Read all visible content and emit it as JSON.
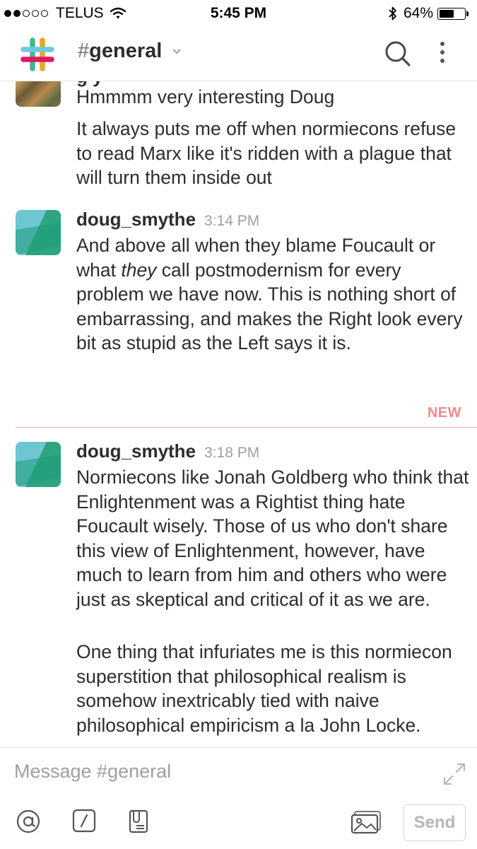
{
  "status_bar": {
    "carrier": "TELUS",
    "time": "5:45 PM",
    "battery": "64%",
    "battery_level": 0.64
  },
  "header": {
    "channel_hash": "#",
    "channel_name": "general",
    "logo_icon": "slack-logo-icon",
    "search_icon": "search-icon",
    "more_icon": "more-vertical-icon"
  },
  "messages": [
    {
      "avatar": "painting-avatar",
      "lines": [
        "Hmmmm very interesting Doug",
        "It always puts me off when normiecons refuse to read Marx like it's ridden with a plague that will turn them inside out"
      ]
    },
    {
      "sender": "doug_smythe",
      "time": "3:14 PM",
      "text_before": "And above all when they blame Foucault or what ",
      "text_em": "they",
      "text_after": " call postmodernism for every problem we have now. This is nothing short of embarrassing, and makes the Right look every bit as stupid as the Left says it is."
    },
    {
      "sender": "doug_smythe",
      "time": "3:18 PM",
      "paragraphs": [
        "Normiecons like Jonah Goldberg who think that Enlightenment was a Rightist thing hate Foucault wisely. Those of us who don't share this view of Enlightenment, however, have much to learn from him and others who were just as skeptical and critical of it as we are.",
        "One thing that infuriates me is this normiecon superstition that philosophical realism is somehow inextricably tied with naive philosophical empiricism a la John Locke."
      ]
    }
  ],
  "new_divider_label": "NEW",
  "composer": {
    "placeholder": "Message #general",
    "send_label": "Send"
  },
  "colors": {
    "new_divider": "#f08c8c",
    "timestamp": "#9e9ea6",
    "text": "#2c2d30"
  }
}
